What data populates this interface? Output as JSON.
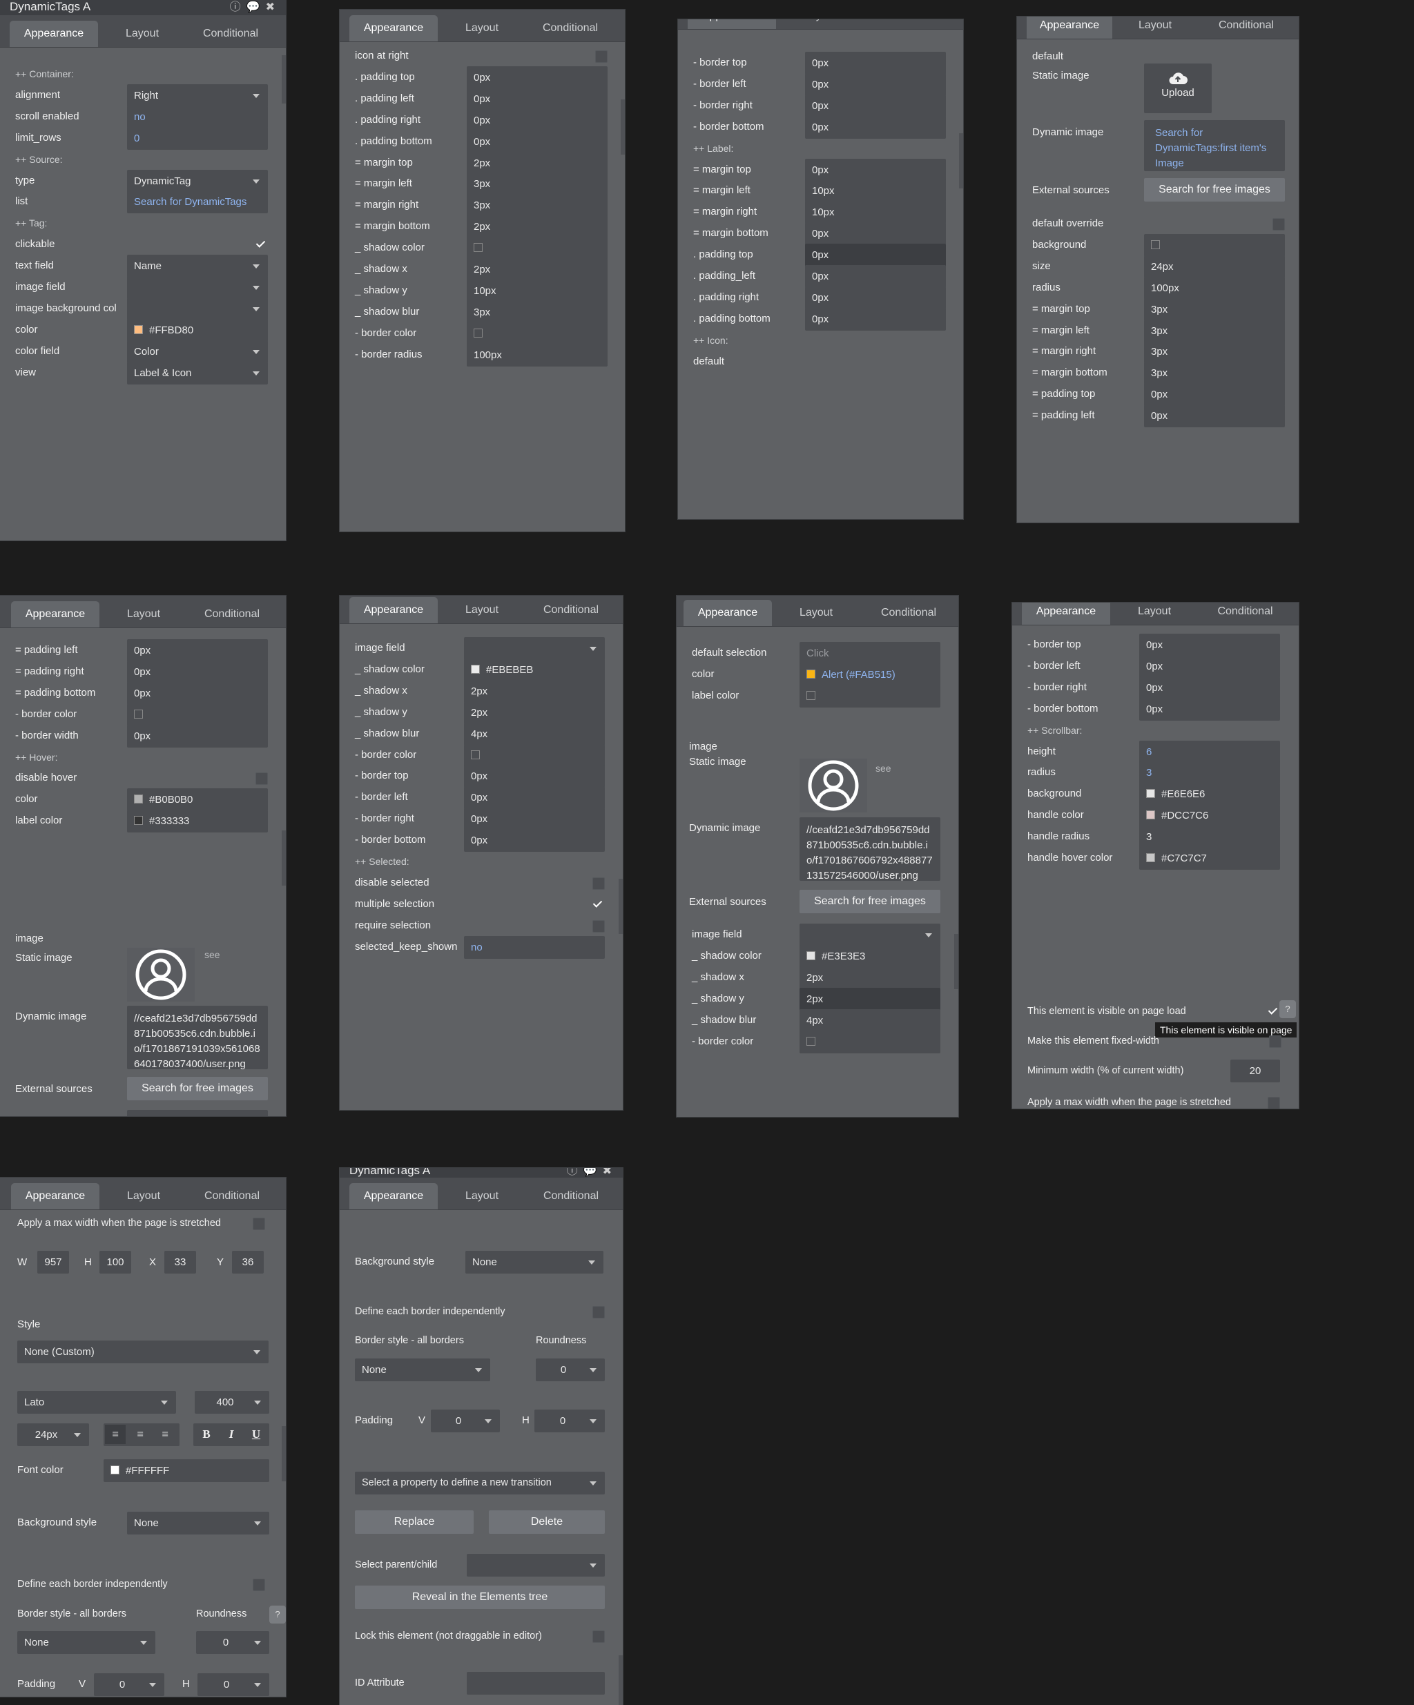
{
  "tabs": {
    "appearance": "Appearance",
    "layout": "Layout",
    "conditional": "Conditional"
  },
  "p1": {
    "title": "DynamicTags A",
    "rows": [
      {
        "label": "++ Container:",
        "kind": "section"
      },
      {
        "label": "alignment",
        "kind": "dropdown",
        "value": "Right"
      },
      {
        "label": "scroll enabled",
        "kind": "text",
        "value": "no",
        "blue": true
      },
      {
        "label": "limit_rows",
        "kind": "text",
        "value": "0",
        "blue": true
      },
      {
        "label": "++ Source:",
        "kind": "section"
      },
      {
        "label": "type",
        "kind": "dropdown",
        "value": "DynamicTag"
      },
      {
        "label": "list",
        "kind": "text",
        "value": "Search for DynamicTags",
        "blue": true
      },
      {
        "label": "++ Tag:",
        "kind": "section"
      },
      {
        "label": "clickable",
        "kind": "check",
        "checked": true
      },
      {
        "label": "text field",
        "kind": "dropdown",
        "value": "Name"
      },
      {
        "label": "image field",
        "kind": "dropdown",
        "value": ""
      },
      {
        "label": "image background col",
        "kind": "dropdown",
        "value": ""
      },
      {
        "label": "color",
        "kind": "color",
        "value": "#FFBD80",
        "swatch": "#FFBD80"
      },
      {
        "label": "color field",
        "kind": "dropdown",
        "value": "Color"
      },
      {
        "label": "view",
        "kind": "dropdown",
        "value": "Label & Icon"
      }
    ]
  },
  "p2": {
    "rows": [
      {
        "label": "icon at right",
        "kind": "check",
        "checked": false
      },
      {
        "label": ". padding top",
        "kind": "text",
        "value": "0px"
      },
      {
        "label": ". padding left",
        "kind": "text",
        "value": "0px"
      },
      {
        "label": ". padding right",
        "kind": "text",
        "value": "0px"
      },
      {
        "label": ". padding bottom",
        "kind": "text",
        "value": "0px"
      },
      {
        "label": "= margin top",
        "kind": "text",
        "value": "2px"
      },
      {
        "label": "= margin left",
        "kind": "text",
        "value": "3px"
      },
      {
        "label": "= margin right",
        "kind": "text",
        "value": "3px"
      },
      {
        "label": "= margin bottom",
        "kind": "text",
        "value": "2px"
      },
      {
        "label": "_ shadow color",
        "kind": "color",
        "value": "",
        "swatch": ""
      },
      {
        "label": "_ shadow x",
        "kind": "text",
        "value": "2px"
      },
      {
        "label": "_ shadow y",
        "kind": "text",
        "value": "10px"
      },
      {
        "label": "_ shadow blur",
        "kind": "text",
        "value": "3px"
      },
      {
        "label": "- border color",
        "kind": "color",
        "value": "",
        "swatch": ""
      },
      {
        "label": "- border radius",
        "kind": "text",
        "value": "100px"
      }
    ]
  },
  "p3": {
    "rows": [
      {
        "label": "- border top",
        "kind": "text",
        "value": "0px"
      },
      {
        "label": "- border left",
        "kind": "text",
        "value": "0px"
      },
      {
        "label": "- border right",
        "kind": "text",
        "value": "0px"
      },
      {
        "label": "- border bottom",
        "kind": "text",
        "value": "0px"
      },
      {
        "label": "++ Label:",
        "kind": "section"
      },
      {
        "label": "= margin top",
        "kind": "text",
        "value": "0px"
      },
      {
        "label": "= margin left",
        "kind": "text",
        "value": "10px"
      },
      {
        "label": "= margin right",
        "kind": "text",
        "value": "10px"
      },
      {
        "label": "= margin bottom",
        "kind": "text",
        "value": "0px"
      },
      {
        "label": ". padding top",
        "kind": "text",
        "value": "0px",
        "dark": true
      },
      {
        "label": ". padding_left",
        "kind": "text",
        "value": "0px"
      },
      {
        "label": ". padding right",
        "kind": "text",
        "value": "0px"
      },
      {
        "label": ". padding bottom",
        "kind": "text",
        "value": "0px"
      },
      {
        "label": "++ Icon:",
        "kind": "section"
      },
      {
        "label": "default",
        "kind": "plain"
      }
    ]
  },
  "p4": {
    "default_label": "default",
    "static_image_label": "Static image",
    "upload_label": "Upload",
    "dynamic_image_label": "Dynamic image",
    "dynamic_image_value": "Search for DynamicTags:first item's Image",
    "external_sources_label": "External sources",
    "external_sources_button": "Search for free images",
    "rows": [
      {
        "label": "default override",
        "kind": "check",
        "checked": false
      },
      {
        "label": "background",
        "kind": "color",
        "value": "",
        "swatch": ""
      },
      {
        "label": "size",
        "kind": "text",
        "value": "24px"
      },
      {
        "label": "radius",
        "kind": "text",
        "value": "100px"
      },
      {
        "label": "= margin top",
        "kind": "text",
        "value": "3px"
      },
      {
        "label": "= margin left",
        "kind": "text",
        "value": "3px"
      },
      {
        "label": "= margin right",
        "kind": "text",
        "value": "3px"
      },
      {
        "label": "= margin bottom",
        "kind": "text",
        "value": "3px"
      },
      {
        "label": "= padding top",
        "kind": "text",
        "value": "0px"
      },
      {
        "label": "= padding left",
        "kind": "text",
        "value": "0px"
      }
    ]
  },
  "p5": {
    "rows": [
      {
        "label": "= padding left",
        "kind": "text",
        "value": "0px"
      },
      {
        "label": "= padding right",
        "kind": "text",
        "value": "0px"
      },
      {
        "label": "= padding bottom",
        "kind": "text",
        "value": "0px"
      },
      {
        "label": "- border color",
        "kind": "color",
        "value": "",
        "swatch": ""
      },
      {
        "label": "- border width",
        "kind": "text",
        "value": "0px"
      },
      {
        "label": "++ Hover:",
        "kind": "section"
      },
      {
        "label": "disable hover",
        "kind": "check",
        "checked": false
      },
      {
        "label": "color",
        "kind": "color",
        "value": "#B0B0B0",
        "swatch": "#B0B0B0"
      },
      {
        "label": "label color",
        "kind": "color",
        "value": "#333333",
        "swatch": "#333333"
      }
    ],
    "image_label": "image",
    "static_image_label": "Static image",
    "see_label": "see",
    "dynamic_image_label": "Dynamic image",
    "dynamic_image_value": "//ceafd21e3d7db956759dd871b00535c6.cdn.bubble.io/f1701867191039x561068640178037400/user.png",
    "external_sources_label": "External sources",
    "external_sources_button": "Search for free images"
  },
  "p6": {
    "rows": [
      {
        "label": "image field",
        "kind": "dropdown",
        "value": ""
      },
      {
        "label": "_ shadow color",
        "kind": "color",
        "value": "#EBEBEB",
        "swatch": "#EBEBEB"
      },
      {
        "label": "_ shadow x",
        "kind": "text",
        "value": "2px"
      },
      {
        "label": "_ shadow y",
        "kind": "text",
        "value": "2px"
      },
      {
        "label": "_ shadow blur",
        "kind": "text",
        "value": "4px"
      },
      {
        "label": "- border color",
        "kind": "color",
        "value": "",
        "swatch": ""
      },
      {
        "label": "- border top",
        "kind": "text",
        "value": "0px"
      },
      {
        "label": "- border left",
        "kind": "text",
        "value": "0px"
      },
      {
        "label": "- border right",
        "kind": "text",
        "value": "0px"
      },
      {
        "label": "- border bottom",
        "kind": "text",
        "value": "0px"
      },
      {
        "label": "++ Selected:",
        "kind": "section"
      },
      {
        "label": "disable selected",
        "kind": "check",
        "checked": false
      },
      {
        "label": "multiple selection",
        "kind": "check",
        "checked": true
      },
      {
        "label": "require selection",
        "kind": "check",
        "checked": false
      },
      {
        "label": "selected_keep_shown",
        "kind": "text",
        "value": "no",
        "blue": true
      }
    ]
  },
  "p7": {
    "rows": [
      {
        "label": "default selection",
        "kind": "text",
        "value": "Click",
        "placeholder": true
      },
      {
        "label": "color",
        "kind": "color",
        "value": "Alert (#FAB515)",
        "swatch": "#FAB515",
        "blue": true
      },
      {
        "label": "label color",
        "kind": "color",
        "value": "",
        "swatch": ""
      }
    ],
    "image_label": "image",
    "static_image_label": "Static image",
    "see_label": "see",
    "dynamic_image_label": "Dynamic image",
    "dynamic_image_value": "//ceafd21e3d7db956759dd871b00535c6.cdn.bubble.io/f1701867606792x488877131572546000/user.png",
    "external_sources_label": "External sources",
    "external_sources_button": "Search for free images",
    "rows2": [
      {
        "label": "image field",
        "kind": "dropdown",
        "value": ""
      },
      {
        "label": "_ shadow color",
        "kind": "color",
        "value": "#E3E3E3",
        "swatch": "#E3E3E3"
      },
      {
        "label": "_ shadow x",
        "kind": "text",
        "value": "2px"
      },
      {
        "label": "_ shadow y",
        "kind": "text",
        "value": "2px",
        "dark": true
      },
      {
        "label": "_ shadow blur",
        "kind": "text",
        "value": "4px"
      },
      {
        "label": "- border color",
        "kind": "color",
        "value": "",
        "swatch": ""
      }
    ]
  },
  "p8": {
    "rows": [
      {
        "label": "- border top",
        "kind": "text",
        "value": "0px"
      },
      {
        "label": "- border left",
        "kind": "text",
        "value": "0px"
      },
      {
        "label": "- border right",
        "kind": "text",
        "value": "0px"
      },
      {
        "label": "- border bottom",
        "kind": "text",
        "value": "0px"
      },
      {
        "label": "++ Scrollbar:",
        "kind": "section"
      },
      {
        "label": "height",
        "kind": "text",
        "value": "6",
        "blue": true
      },
      {
        "label": "radius",
        "kind": "text",
        "value": "3",
        "blue": true
      },
      {
        "label": "background",
        "kind": "color",
        "value": "#E6E6E6",
        "swatch": "#E6E6E6"
      },
      {
        "label": "handle color",
        "kind": "color",
        "value": "#DCC7C6",
        "swatch": "#DCC7C6"
      },
      {
        "label": "handle radius",
        "kind": "text",
        "value": "3"
      },
      {
        "label": "handle hover color",
        "kind": "color",
        "value": "#C7C7C7",
        "swatch": "#C7C7C7"
      }
    ],
    "visible_label": "This element is visible on page load",
    "tooltip": "This element is visible on page",
    "fixed_label": "Make this element fixed-width",
    "min_width_label": "Minimum width (% of current width)",
    "min_width_value": "20",
    "max_width_label": "Apply a max width when the page is stretched"
  },
  "p9": {
    "max_width_label": "Apply a max width when the page is stretched",
    "w_label": "W",
    "w": "957",
    "h_label": "H",
    "h": "100",
    "x_label": "X",
    "x": "33",
    "y_label": "Y",
    "y": "36",
    "style_label": "Style",
    "style_value": "None (Custom)",
    "font": "Lato",
    "weight": "400",
    "size": "24px",
    "bold": "B",
    "italic": "I",
    "underline": "U",
    "font_color_label": "Font color",
    "font_color": "#FFFFFF",
    "bg_style_label": "Background style",
    "bg_style": "None",
    "define_border_label": "Define each border independently",
    "border_style_label": "Border style - all borders",
    "roundness_label": "Roundness",
    "border_style": "None",
    "roundness": "0",
    "padding_label": "Padding",
    "v_label": "V",
    "v": "0",
    "h2_label": "H",
    "h2": "0",
    "help": "?"
  },
  "p10": {
    "title": "DynamicTags A",
    "bg_style_label": "Background style",
    "bg_style": "None",
    "define_border_label": "Define each border independently",
    "border_style_label": "Border style - all borders",
    "roundness_label": "Roundness",
    "border_style": "None",
    "roundness": "0",
    "padding_label": "Padding",
    "v_label": "V",
    "v": "0",
    "h_label": "H",
    "h": "0",
    "transition": "Select a property to define a new transition",
    "replace": "Replace",
    "delete": "Delete",
    "parent_label": "Select parent/child",
    "reveal": "Reveal in the Elements tree",
    "lock_label": "Lock this element (not draggable in editor)",
    "id_label": "ID Attribute"
  }
}
